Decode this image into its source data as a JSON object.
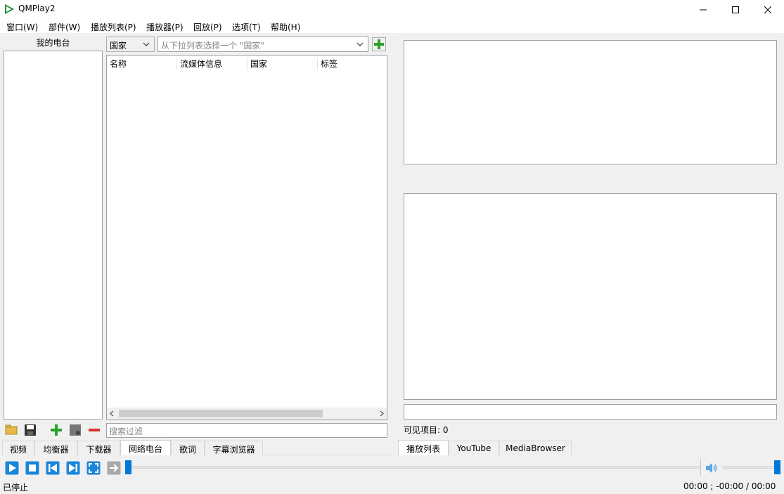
{
  "window": {
    "title": "QMPlay2",
    "min_icon": "minimize-icon",
    "max_icon": "maximize-icon",
    "close_icon": "close-icon"
  },
  "menu": {
    "items": [
      "窗口(W)",
      "部件(W)",
      "播放列表(P)",
      "播放器(P)",
      "回放(P)",
      "选项(T)",
      "帮助(H)"
    ]
  },
  "radio": {
    "my_station_title": "我的电台",
    "filter_type": "国家",
    "filter_placeholder": "从下拉列表选择一个 \"国家\"",
    "columns": [
      "名称",
      "流媒体信息",
      "国家",
      "标签"
    ],
    "search_placeholder": "搜索过滤"
  },
  "right_panel": {
    "visible_items_label": "可见项目: 0"
  },
  "left_tabs": [
    "视频",
    "均衡器",
    "下载器",
    "网络电台",
    "歌词",
    "字幕浏览器"
  ],
  "left_active_tab": 3,
  "right_tabs": [
    "播放列表",
    "YouTube",
    "MediaBrowser"
  ],
  "right_active_tab": 0,
  "status": {
    "state": "已停止",
    "time": "00:00 ; -00:00 / 00:00"
  },
  "colors": {
    "accent": "#0078d7",
    "green": "#2aa12a",
    "red": "#d9332a"
  }
}
